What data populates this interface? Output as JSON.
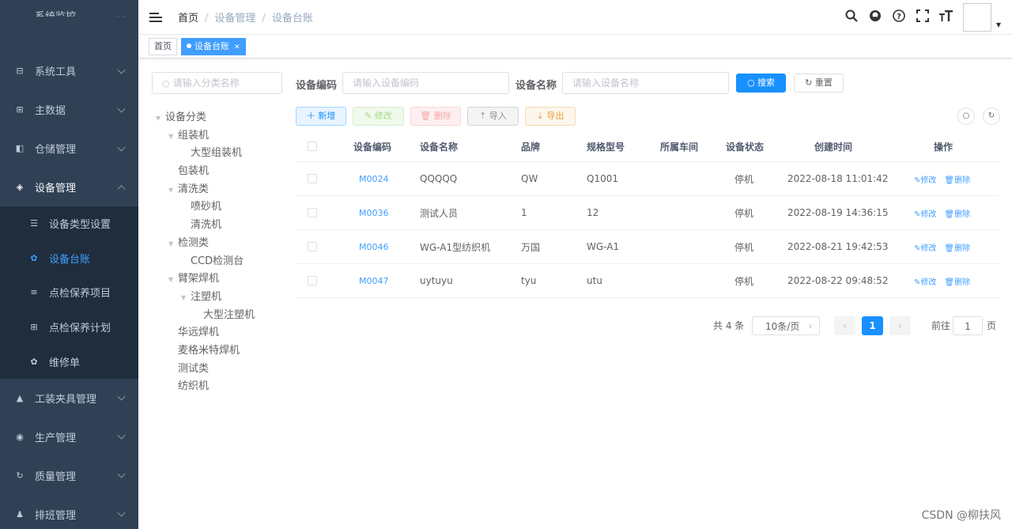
{
  "sidebar": {
    "partial_item": "系统监控",
    "items": [
      {
        "label": "系统工具",
        "icon": "toolbox-icon"
      },
      {
        "label": "主数据",
        "icon": "grid-icon"
      },
      {
        "label": "仓储管理",
        "icon": "warehouse-icon"
      },
      {
        "label": "设备管理",
        "icon": "layers-icon"
      }
    ],
    "sub_items": [
      {
        "label": "设备类型设置",
        "icon": "sliders-icon"
      },
      {
        "label": "设备台账",
        "icon": "gear-icon"
      },
      {
        "label": "点检保养项目",
        "icon": "checklist-icon"
      },
      {
        "label": "点检保养计划",
        "icon": "table-icon"
      },
      {
        "label": "维修单",
        "icon": "gear-icon"
      }
    ],
    "bottom_items": [
      {
        "label": "工装夹具管理",
        "icon": "lock-icon"
      },
      {
        "label": "生产管理",
        "icon": "toggle-icon"
      },
      {
        "label": "质量管理",
        "icon": "refresh-icon"
      },
      {
        "label": "排班管理",
        "icon": "users-icon"
      }
    ]
  },
  "breadcrumb": [
    "首页",
    "设备管理",
    "设备台账"
  ],
  "tags": {
    "home": "首页",
    "current": "设备台账"
  },
  "tree": {
    "search_placeholder": "请输入分类名称",
    "nodes": [
      {
        "label": "设备分类",
        "level": 0,
        "expandable": true
      },
      {
        "label": "组装机",
        "level": 1,
        "expandable": true
      },
      {
        "label": "大型组装机",
        "level": 2,
        "expandable": false
      },
      {
        "label": "包装机",
        "level": 1,
        "expandable": false
      },
      {
        "label": "清洗类",
        "level": 1,
        "expandable": true
      },
      {
        "label": "喷砂机",
        "level": 2,
        "expandable": false
      },
      {
        "label": "清洗机",
        "level": 2,
        "expandable": false
      },
      {
        "label": "检测类",
        "level": 1,
        "expandable": true
      },
      {
        "label": "CCD检测台",
        "level": 2,
        "expandable": false
      },
      {
        "label": "臂架焊机",
        "level": 1,
        "expandable": true
      },
      {
        "label": "注塑机",
        "level": 2,
        "expandable": true
      },
      {
        "label": "大型注塑机",
        "level": 3,
        "expandable": false
      },
      {
        "label": "华远焊机",
        "level": 1,
        "expandable": false
      },
      {
        "label": "麦格米特焊机",
        "level": 1,
        "expandable": false
      },
      {
        "label": "测试类",
        "level": 1,
        "expandable": false
      },
      {
        "label": "纺织机",
        "level": 1,
        "expandable": false
      }
    ]
  },
  "search": {
    "code_label": "设备编码",
    "code_placeholder": "请输入设备编码",
    "name_label": "设备名称",
    "name_placeholder": "请输入设备名称",
    "search_btn": "搜索",
    "reset_btn": "重置"
  },
  "toolbar": {
    "add": "新增",
    "edit": "修改",
    "delete": "删除",
    "import": "导入",
    "export": "导出"
  },
  "table": {
    "headers": [
      "设备编码",
      "设备名称",
      "品牌",
      "规格型号",
      "所属车间",
      "设备状态",
      "创建时间",
      "操作"
    ],
    "edit_label": "修改",
    "delete_label": "删除",
    "rows": [
      {
        "code": "M0024",
        "name": "QQQQQ",
        "brand": "QW",
        "spec": "Q1001",
        "workshop": "",
        "status": "停机",
        "created": "2022-08-18 11:01:42"
      },
      {
        "code": "M0036",
        "name": "测试人员",
        "brand": "1",
        "spec": "12",
        "workshop": "",
        "status": "停机",
        "created": "2022-08-19 14:36:15"
      },
      {
        "code": "M0046",
        "name": "WG-A1型纺织机",
        "brand": "万国",
        "spec": "WG-A1",
        "workshop": "",
        "status": "停机",
        "created": "2022-08-21 19:42:53"
      },
      {
        "code": "M0047",
        "name": "uytuyu",
        "brand": "tyu",
        "spec": "utu",
        "workshop": "",
        "status": "停机",
        "created": "2022-08-22 09:48:52"
      }
    ]
  },
  "pagination": {
    "total": "共 4 条",
    "page_size": "10条/页",
    "current_page": "1",
    "goto_label": "前往",
    "goto_value": "1",
    "page_unit": "页"
  },
  "watermark": "CSDN @柳扶风",
  "colors": {
    "sidebar_bg": "#304156",
    "submenu_bg": "#1f2d3d",
    "accent": "#409eff"
  }
}
